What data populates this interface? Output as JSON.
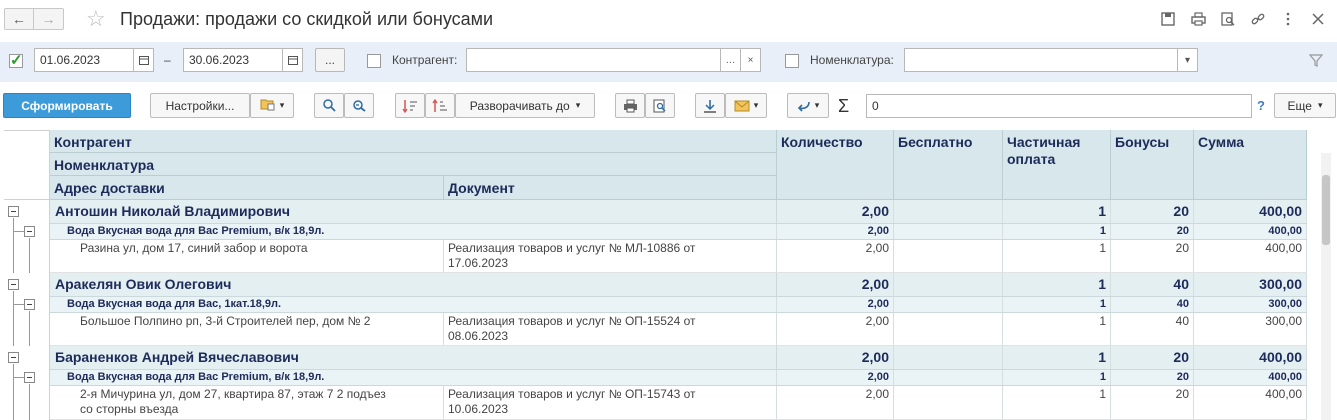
{
  "window": {
    "title": "Продажи: продажи со скидкой или бонусами",
    "back_glyph": "←",
    "forward_glyph": "→",
    "star_glyph": "☆",
    "icons": [
      "save-icon",
      "print-icon",
      "preview-icon",
      "link-icon",
      "more-icon",
      "close-icon"
    ]
  },
  "filters": {
    "period_enabled": true,
    "date_from": "01.06.2023",
    "date_sep": "–",
    "date_to": "30.06.2023",
    "period_btn_label": "...",
    "counterparty_label": "Контрагент:",
    "counterparty_value": "",
    "item_label": "Номенклатура:",
    "item_value": ""
  },
  "toolbar": {
    "generate_label": "Сформировать",
    "settings_label": "Настройки...",
    "expand_label": "Разворачивать до",
    "sum_value": "0",
    "more_label": "Еще",
    "help_label": "?"
  },
  "report": {
    "headers": {
      "counterparty": "Контрагент",
      "item": "Номенклатура",
      "address": "Адрес доставки",
      "document": "Документ",
      "qty": "Количество",
      "free": "Бесплатно",
      "partial": "Частичная оплата",
      "bonus": "Бонусы",
      "sum": "Сумма"
    },
    "groups": [
      {
        "name": "Антошин Николай Владимирович",
        "qty": "2,00",
        "free": "",
        "partial": "1",
        "bonus": "20",
        "sum": "400,00",
        "item": {
          "name": "Вода Вкусная вода для Вас Premium, в/к 18,9л.",
          "qty": "2,00",
          "free": "",
          "partial": "1",
          "bonus": "20",
          "sum": "400,00"
        },
        "detail": {
          "address": "Разина ул,  дом 17, синий забор и ворота",
          "document_line1": "Реализация товаров и услуг № МЛ-10886 от",
          "document_line2": "17.06.2023",
          "qty": "2,00",
          "free": "",
          "partial": "1",
          "bonus": "20",
          "sum": "400,00"
        }
      },
      {
        "name": "Аракелян Овик Олегович",
        "qty": "2,00",
        "free": "",
        "partial": "1",
        "bonus": "40",
        "sum": "300,00",
        "item": {
          "name": "Вода Вкусная вода для Вас, 1кат.18,9л.",
          "qty": "2,00",
          "free": "",
          "partial": "1",
          "bonus": "40",
          "sum": "300,00"
        },
        "detail": {
          "address": "Большое Полпино рп,  3-й Строителей пер,  дом № 2",
          "document_line1": "Реализация товаров и услуг № ОП-15524 от",
          "document_line2": "08.06.2023",
          "qty": "2,00",
          "free": "",
          "partial": "1",
          "bonus": "40",
          "sum": "300,00"
        }
      },
      {
        "name": "Бараненков Андрей Вячеславович",
        "qty": "2,00",
        "free": "",
        "partial": "1",
        "bonus": "20",
        "sum": "400,00",
        "item": {
          "name": "Вода Вкусная вода для Вас Premium, в/к 18,9л.",
          "qty": "2,00",
          "free": "",
          "partial": "1",
          "bonus": "20",
          "sum": "400,00"
        },
        "detail": {
          "address_line1": "2-я Мичурина ул,  дом 27,  квартира 87,  этаж 7 2 подъез",
          "address_line2": "со сторны въезда",
          "document_line1": "Реализация товаров и услуг № ОП-15743 от",
          "document_line2": "10.06.2023",
          "qty": "2,00",
          "free": "",
          "partial": "1",
          "bonus": "20",
          "sum": "400,00"
        }
      }
    ]
  }
}
